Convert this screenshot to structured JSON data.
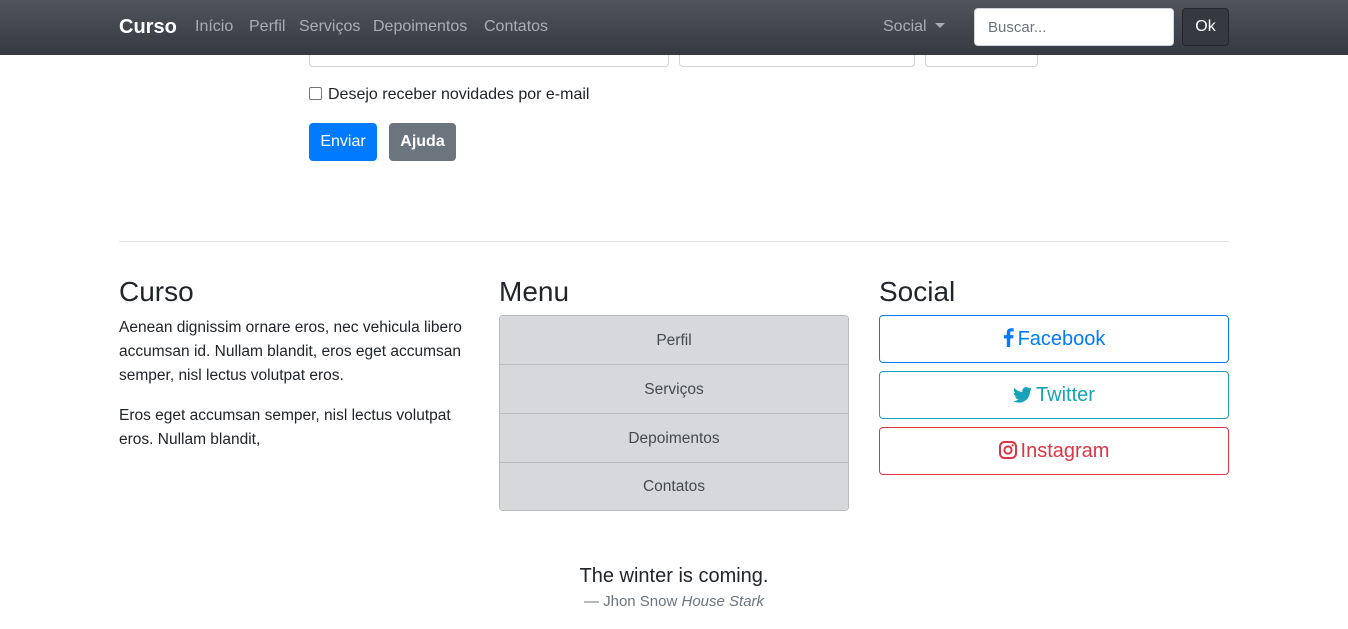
{
  "navbar": {
    "brand": "Curso",
    "links": [
      "Início",
      "Perfil",
      "Serviços",
      "Depoimentos",
      "Contatos"
    ],
    "social_dropdown": "Social",
    "search_placeholder": "Buscar...",
    "search_button": "Ok"
  },
  "form": {
    "checkbox_label": "Desejo receber novidades por e-mail",
    "submit_label": "Enviar",
    "help_label": "Ajuda"
  },
  "footer": {
    "about": {
      "title": "Curso",
      "paragraph1": "Aenean dignissim ornare eros, nec vehicula libero accumsan id. Nullam blandit, eros eget accumsan semper, nisl lectus volutpat eros.",
      "paragraph2": "Eros eget accumsan semper, nisl lectus volutpat eros. Nullam blandit,"
    },
    "menu": {
      "title": "Menu",
      "items": [
        "Perfil",
        "Serviços",
        "Depoimentos",
        "Contatos"
      ]
    },
    "social": {
      "title": "Social",
      "facebook": "Facebook",
      "twitter": "Twitter",
      "instagram": "Instagram"
    },
    "quote": {
      "text": "The winter is coming.",
      "author": "— Jhon Snow",
      "source": "House Stark"
    }
  },
  "colors": {
    "primary": "#007bff",
    "secondary": "#6c757d",
    "info": "#17a2b8",
    "danger": "#dc3545",
    "navbar": "#343a40"
  }
}
